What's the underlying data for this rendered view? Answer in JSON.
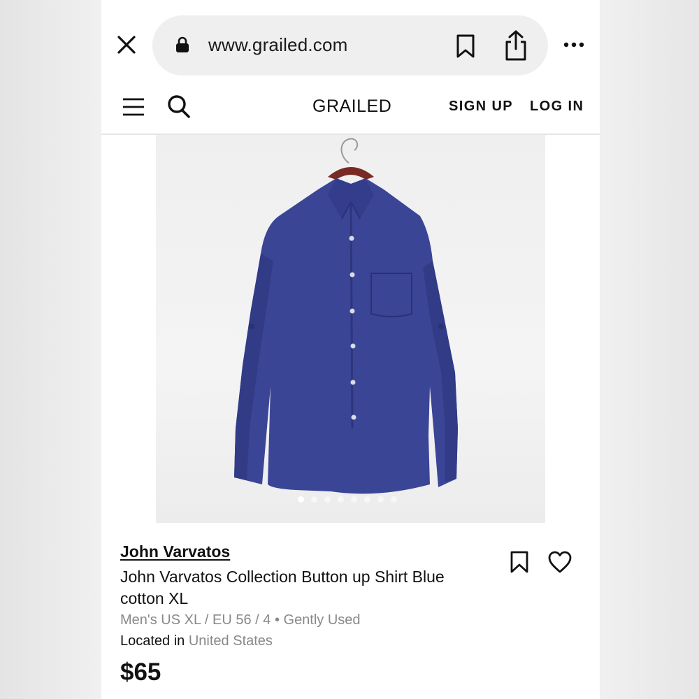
{
  "browser": {
    "url": "www.grailed.com",
    "icons": {
      "close": "close-icon",
      "lock": "lock-icon",
      "bookmark": "bookmark-icon",
      "share": "share-icon",
      "more": "more-icon"
    }
  },
  "header": {
    "logo": "GRAILED",
    "sign_up": "SIGN UP",
    "log_in": "LOG IN",
    "icons": {
      "menu": "hamburger-menu-icon",
      "search": "search-icon"
    }
  },
  "product": {
    "image": {
      "description_icon": "shirt-photo",
      "carousel": {
        "count": 8,
        "active_index": 0
      }
    },
    "brand": "John Varvatos",
    "title": "John Varvatos Collection Button up Shirt Blue cotton XL",
    "meta": "Men's US XL / EU 56 / 4 • Gently Used",
    "location_label": "Located in",
    "location_value": "United States",
    "price": "$65",
    "icons": {
      "save": "bookmark-icon",
      "favorite": "heart-icon"
    }
  },
  "colors": {
    "page_bg": "#ebebeb",
    "url_pill": "#efeff0",
    "text_primary": "#111111",
    "text_secondary": "#888888",
    "shirt": "#3b4596"
  }
}
